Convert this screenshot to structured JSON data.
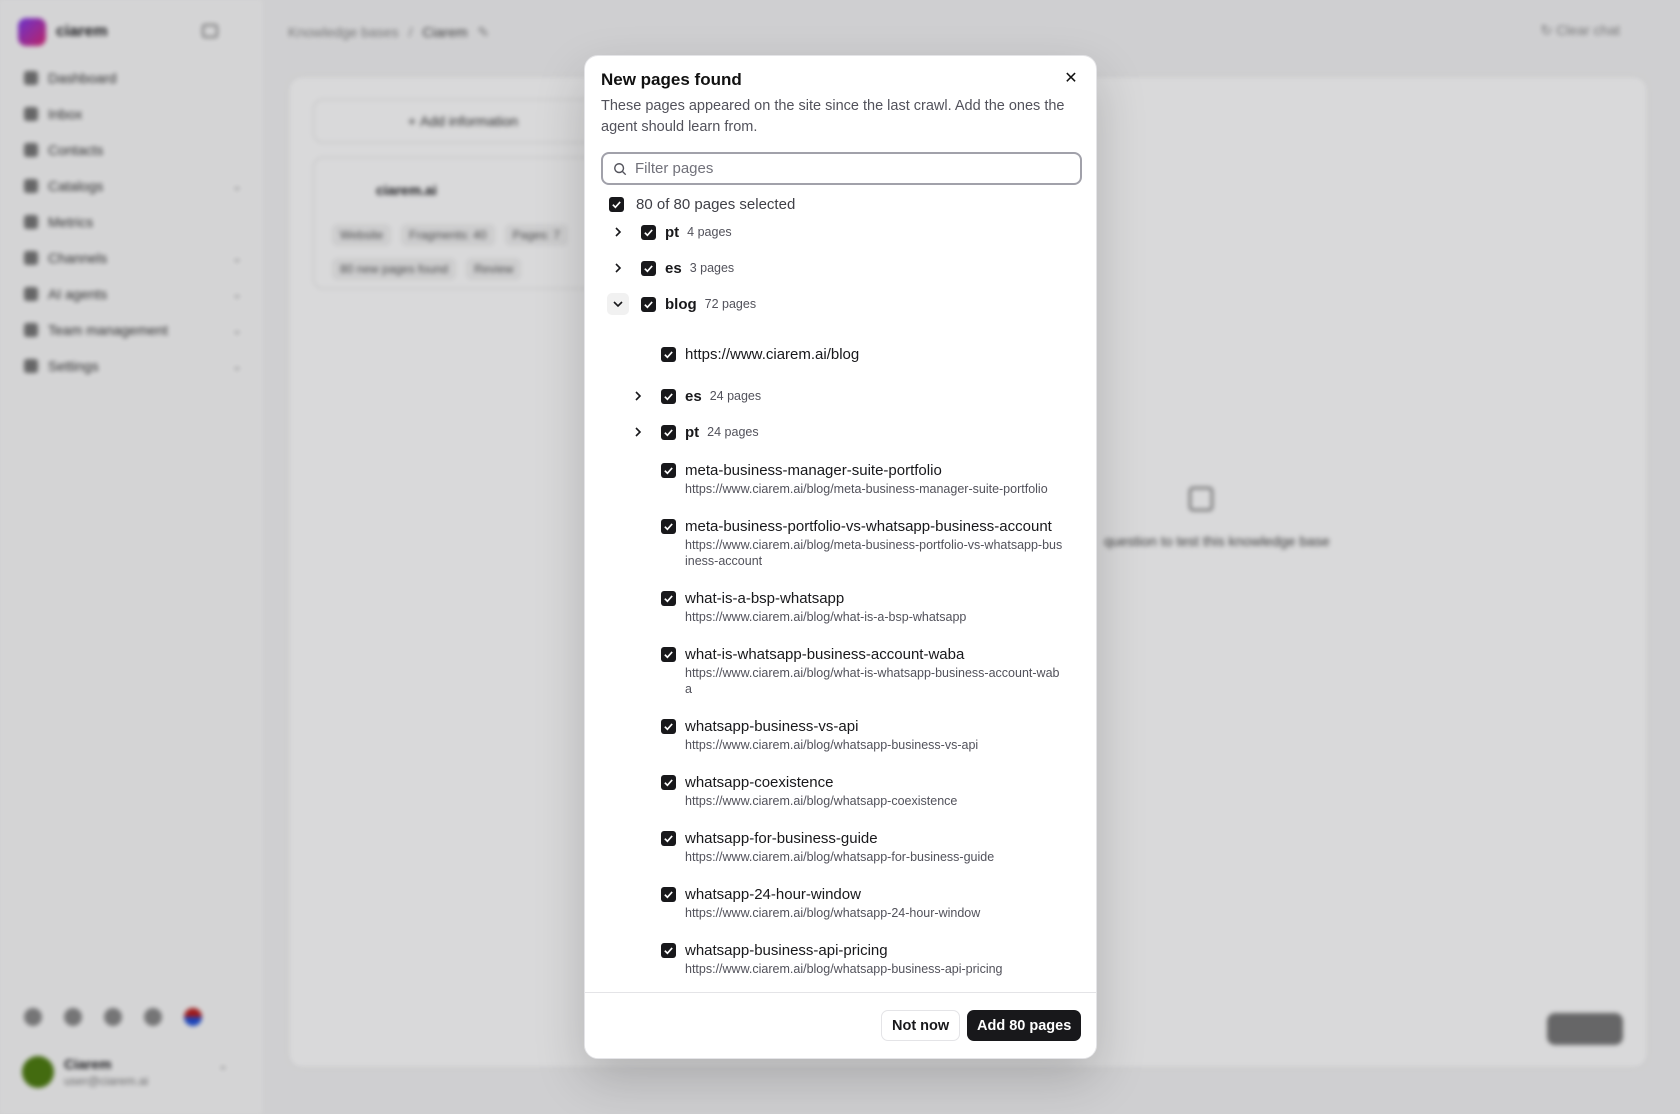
{
  "background": {
    "brand": "ciarem",
    "nav": [
      {
        "label": "Dashboard",
        "has_chevron": false
      },
      {
        "label": "Inbox",
        "has_chevron": false
      },
      {
        "label": "Contacts",
        "has_chevron": false
      },
      {
        "label": "Catalogs",
        "has_chevron": true
      },
      {
        "label": "Metrics",
        "has_chevron": false
      },
      {
        "label": "Channels",
        "has_chevron": true
      },
      {
        "label": "AI agents",
        "has_chevron": true
      },
      {
        "label": "Team management",
        "has_chevron": true
      },
      {
        "label": "Settings",
        "has_chevron": true
      }
    ],
    "breadcrumb": {
      "root": "Knowledge bases",
      "separator": "/",
      "current": "Ciarem"
    },
    "clear_chat": "Clear chat",
    "add_information": "Add information",
    "kb_card": {
      "title": "ciarem.ai",
      "tags": [
        "Website",
        "Fragments: 40",
        "Pages: 7"
      ],
      "tags2": [
        "80 new pages found",
        "Review"
      ]
    },
    "empty_text": "question to test this knowledge base",
    "user": {
      "name": "Ciarem",
      "email": "user@ciarem.ai"
    }
  },
  "modal": {
    "title": "New pages found",
    "description": "These pages appeared on the site since the last crawl. Add the ones the agent should learn from.",
    "filter_placeholder": "Filter pages",
    "selection_summary": "80 of 80 pages selected",
    "groups": [
      {
        "name": "pt",
        "count": "4 pages",
        "expanded": false
      },
      {
        "name": "es",
        "count": "3 pages",
        "expanded": false
      },
      {
        "name": "blog",
        "count": "72 pages",
        "expanded": true
      }
    ],
    "blog_root_url": "https://www.ciarem.ai/blog",
    "subgroups": [
      {
        "name": "es",
        "count": "24 pages"
      },
      {
        "name": "pt",
        "count": "24 pages"
      }
    ],
    "pages": [
      {
        "title": "meta-business-manager-suite-portfolio",
        "url": "https://www.ciarem.ai/blog/meta-business-manager-suite-portfolio"
      },
      {
        "title": "meta-business-portfolio-vs-whatsapp-business-account",
        "url": "https://www.ciarem.ai/blog/meta-business-portfolio-vs-whatsapp-business-account"
      },
      {
        "title": "what-is-a-bsp-whatsapp",
        "url": "https://www.ciarem.ai/blog/what-is-a-bsp-whatsapp"
      },
      {
        "title": "what-is-whatsapp-business-account-waba",
        "url": "https://www.ciarem.ai/blog/what-is-whatsapp-business-account-waba"
      },
      {
        "title": "whatsapp-business-vs-api",
        "url": "https://www.ciarem.ai/blog/whatsapp-business-vs-api"
      },
      {
        "title": "whatsapp-coexistence",
        "url": "https://www.ciarem.ai/blog/whatsapp-coexistence"
      },
      {
        "title": "whatsapp-for-business-guide",
        "url": "https://www.ciarem.ai/blog/whatsapp-for-business-guide"
      },
      {
        "title": "whatsapp-24-hour-window",
        "url": "https://www.ciarem.ai/blog/whatsapp-24-hour-window"
      },
      {
        "title": "whatsapp-business-api-pricing",
        "url": "https://www.ciarem.ai/blog/whatsapp-business-api-pricing"
      }
    ],
    "buttons": {
      "not_now": "Not now",
      "add": "Add 80 pages"
    }
  }
}
